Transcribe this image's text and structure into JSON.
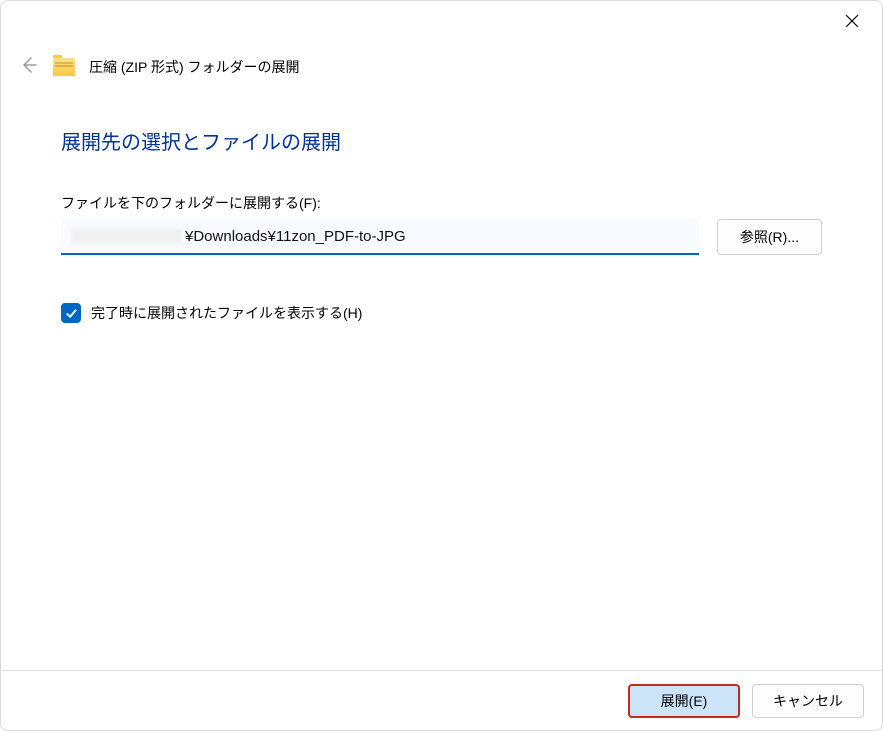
{
  "titlebar": {
    "close_icon": "✕"
  },
  "header": {
    "window_title": "圧縮 (ZIP 形式) フォルダーの展開"
  },
  "content": {
    "main_heading": "展開先の選択とファイルの展開",
    "field_label": "ファイルを下のフォルダーに展開する(F):",
    "path_value": "¥Downloads¥11zon_PDF-to-JPG",
    "browse_button": "参照(R)...",
    "checkbox_checked": true,
    "checkbox_label": "完了時に展開されたファイルを表示する(H)"
  },
  "footer": {
    "extract_button": "展開(E)",
    "cancel_button": "キャンセル"
  }
}
